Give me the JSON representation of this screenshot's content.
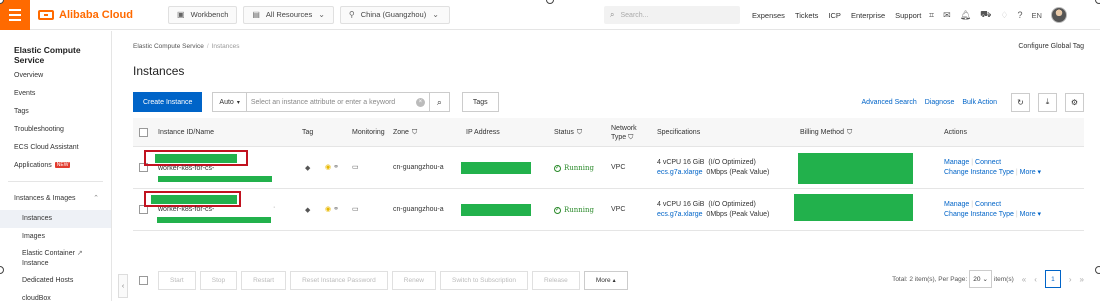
{
  "topbar": {
    "logo_text": "Alibaba Cloud",
    "workbench": "Workbench",
    "resources": "All Resources",
    "region": "China (Guangzhou)",
    "search_placeholder": "Search...",
    "nav": [
      "Expenses",
      "Tickets",
      "ICP",
      "Enterprise",
      "Support"
    ],
    "lang": "EN"
  },
  "sidebar": {
    "title": "Elastic Compute Service",
    "items": [
      "Overview",
      "Events",
      "Tags",
      "Troubleshooting",
      "ECS Cloud Assistant",
      "Applications"
    ],
    "new_badge": "NEW",
    "group": "Instances & Images",
    "sub_items": [
      "Instances",
      "Images"
    ],
    "eci_line1": "Elastic Container",
    "eci_line2": "Instance",
    "more_items": [
      "Dedicated Hosts",
      "cloudBox"
    ]
  },
  "main": {
    "breadcrumb": [
      "Elastic Compute Service",
      "Instances"
    ],
    "config_tag": "Configure Global Tag",
    "title": "Instances",
    "toolbar": {
      "create": "Create Instance",
      "filter": "Auto",
      "search_placeholder": "Select an instance attribute or enter a keyword",
      "tags": "Tags",
      "advanced_search": "Advanced Search",
      "diagnose": "Diagnose",
      "bulk_action": "Bulk Action"
    },
    "table": {
      "headers": {
        "id_name": "Instance ID/Name",
        "tag": "Tag",
        "monitoring": "Monitoring",
        "zone": "Zone",
        "ip": "IP Address",
        "status": "Status",
        "network_line1": "Network",
        "network_line2": "Type",
        "spec": "Specifications",
        "billing": "Billing Method",
        "actions": "Actions"
      },
      "rows": [
        {
          "name": "worker-k8s-for-cs-",
          "zone": "cn-guangzhou-a",
          "status": "Running",
          "network": "VPC",
          "spec_line1": "4 vCPU 16 GiB",
          "spec_opt": "(I/O Optimized)",
          "spec_type": "ecs.g7a.xlarge",
          "bandwidth": "0Mbps (Peak Value)",
          "manage": "Manage",
          "connect": "Connect",
          "change_type": "Change Instance Type",
          "more": "More"
        },
        {
          "name": "worker-k8s-for-cs-",
          "zone": "cn-guangzhou-a",
          "status": "Running",
          "network": "VPC",
          "spec_line1": "4 vCPU 16 GiB",
          "spec_opt": "(I/O Optimized)",
          "spec_type": "ecs.g7a.xlarge",
          "bandwidth": "0Mbps (Peak Value)",
          "manage": "Manage",
          "connect": "Connect",
          "change_type": "Change Instance Type",
          "more": "More"
        }
      ]
    },
    "footer": {
      "buttons": [
        "Start",
        "Stop",
        "Restart",
        "Reset Instance Password",
        "Renew",
        "Switch to Subscription",
        "Release"
      ],
      "more": "More",
      "total": "Total: 2 item(s), Per Page:",
      "page_size": "20",
      "items_suffix": "item(s)",
      "current_page": "1"
    }
  },
  "colors": {
    "brand": "#ff6a00",
    "primary": "#0064c8",
    "redacted": "#22b14c",
    "highlight": "#c1121f"
  }
}
